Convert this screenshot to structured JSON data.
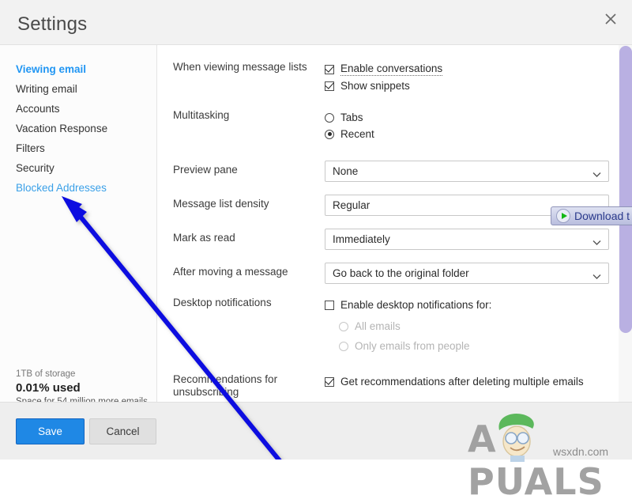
{
  "window": {
    "title": "Settings",
    "close_icon": "close-icon"
  },
  "sidebar": {
    "items": [
      {
        "label": "Viewing email",
        "state": "active"
      },
      {
        "label": "Writing email",
        "state": "normal"
      },
      {
        "label": "Accounts",
        "state": "normal"
      },
      {
        "label": "Vacation Response",
        "state": "normal"
      },
      {
        "label": "Filters",
        "state": "normal"
      },
      {
        "label": "Security",
        "state": "normal"
      },
      {
        "label": "Blocked Addresses",
        "state": "link"
      }
    ],
    "storage": {
      "total": "1TB of storage",
      "used": "0.01% used",
      "note": "Space for 54 million more emails"
    }
  },
  "settings": {
    "rows": [
      {
        "label": "When viewing message lists",
        "checkboxes": [
          {
            "label": "Enable conversations",
            "checked": true,
            "hint": true
          },
          {
            "label": "Show snippets",
            "checked": true,
            "hint": false
          }
        ]
      },
      {
        "label": "Multitasking",
        "radios": [
          {
            "label": "Tabs",
            "selected": false
          },
          {
            "label": "Recent",
            "selected": true
          }
        ]
      },
      {
        "label": "Preview pane",
        "select_value": "None"
      },
      {
        "label": "Message list density",
        "select_value": "Regular"
      },
      {
        "label": "Mark as read",
        "select_value": "Immediately"
      },
      {
        "label": "After moving a message",
        "select_value": "Go back to the original folder"
      },
      {
        "label": "Desktop notifications",
        "checkbox": {
          "label": "Enable desktop notifications for:",
          "checked": false
        },
        "radios": [
          {
            "label": "All emails",
            "selected": false,
            "disabled": true
          },
          {
            "label": "Only emails from people",
            "selected": false,
            "disabled": true
          }
        ]
      },
      {
        "label": "Recommendations for unsubscribing",
        "checkbox": {
          "label": "Get recommendations after deleting multiple emails",
          "checked": true
        }
      }
    ],
    "select_options": {
      "preview_pane": [
        "None"
      ],
      "density": [
        "Regular"
      ],
      "mark_as_read": [
        "Immediately"
      ],
      "after_moving": [
        "Go back to the original folder"
      ]
    }
  },
  "footer": {
    "save_label": "Save",
    "cancel_label": "Cancel"
  },
  "overlay": {
    "download_label": "Download t",
    "play_icon": "play-icon",
    "arrow_icon": "arrow-pointer-annotation"
  },
  "watermark": {
    "text": "A PUALS",
    "url": "wsxdn.com"
  },
  "colors": {
    "accent": "#2196f3",
    "link": "#3aa0e8",
    "save_button": "#1f88e5",
    "scrollbar_thumb": "#b9b0e2",
    "arrow": "#0a0ae0",
    "header_bg": "#f2f2f2",
    "footer_bg": "#eeeeee"
  }
}
